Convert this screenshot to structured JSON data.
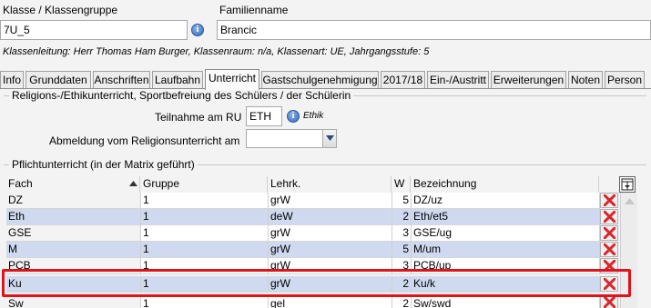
{
  "header": {
    "class_label": "Klasse / Klassengruppe",
    "class_value": "7U_5",
    "family_label": "Familienname",
    "family_value": "Brancic",
    "info_line": "Klassenleitung: Herr Thomas Ham Burger, Klassenraum: n/a, Klassenart: UE, Jahrgangsstufe: 5"
  },
  "tabs": [
    {
      "label": "Info"
    },
    {
      "label": "Grunddaten"
    },
    {
      "label": "Anschriften"
    },
    {
      "label": "Laufbahn"
    },
    {
      "label": "Unterricht",
      "active": true
    },
    {
      "label": "Gastschulgenehmigung"
    },
    {
      "label": "2017/18"
    },
    {
      "label": "Ein-/Austritt"
    },
    {
      "label": "Erweiterungen"
    },
    {
      "label": "Noten"
    },
    {
      "label": "Person"
    }
  ],
  "religion": {
    "group_title": "Religions-/Ethikunterricht, Sportbefreiung des Schülers / der Schülerin",
    "ru_label": "Teilnahme am RU",
    "ru_value": "ETH",
    "ru_hint": "Ethik",
    "abmeldung_label": "Abmeldung vom Religionsunterricht am",
    "abmeldung_value": ""
  },
  "pflicht": {
    "group_title": "Pflichtunterricht (in der Matrix geführt)",
    "columns": {
      "fach": "Fach",
      "gruppe": "Gruppe",
      "lehrk": "Lehrk.",
      "w": "W",
      "bez": "Bezeichnung"
    },
    "rows": [
      {
        "fach": "DZ",
        "gruppe": "1",
        "lehrk": "grW",
        "w": "5",
        "bez": "DZ/uz"
      },
      {
        "fach": "Eth",
        "gruppe": "1",
        "lehrk": "deW",
        "w": "2",
        "bez": "Eth/et5"
      },
      {
        "fach": "GSE",
        "gruppe": "1",
        "lehrk": "grW",
        "w": "3",
        "bez": "GSE/ug"
      },
      {
        "fach": "M",
        "gruppe": "1",
        "lehrk": "grW",
        "w": "5",
        "bez": "M/um"
      },
      {
        "fach": "PCB",
        "gruppe": "1",
        "lehrk": "grW",
        "w": "3",
        "bez": "PCB/up"
      },
      {
        "fach": "Ku",
        "gruppe": "1",
        "lehrk": "grW",
        "w": "2",
        "bez": "Ku/k"
      },
      {
        "fach": "Sw",
        "gruppe": "1",
        "lehrk": "gel",
        "w": "2",
        "bez": "Sw/swd"
      }
    ]
  },
  "colors": {
    "row_alt": "#cfdaf0",
    "highlight": "#e0121c",
    "delete_icon": "#d9262c"
  }
}
